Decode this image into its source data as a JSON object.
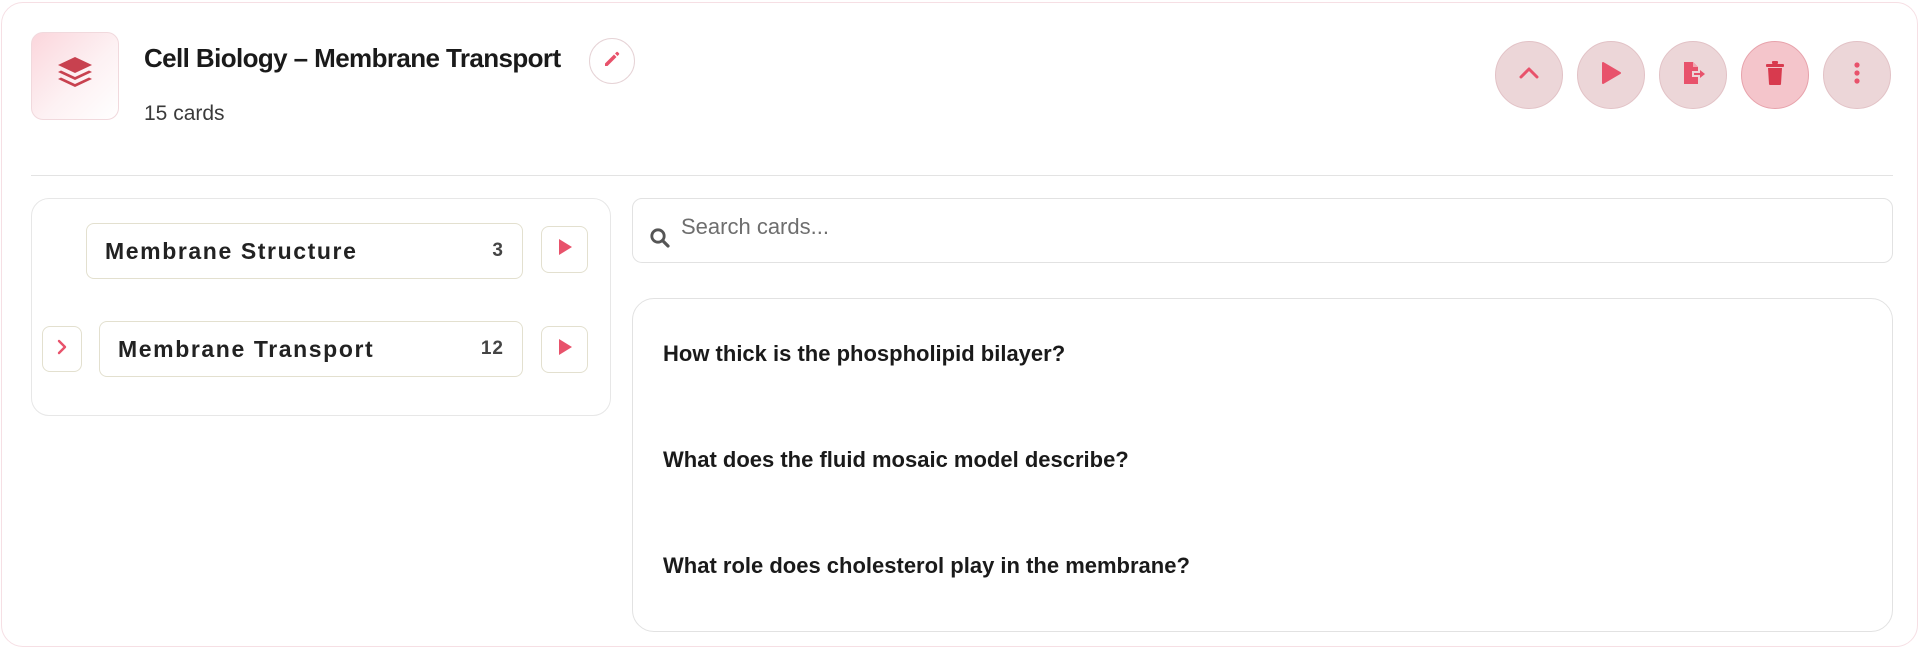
{
  "header": {
    "title": "Cell Biology – Membrane Transport",
    "count_text": "15 cards",
    "icons": {
      "deck": "stack-layers-icon",
      "edit": "pencil-icon"
    }
  },
  "actions": [
    {
      "name": "collapse-button",
      "icon": "chevron-up-icon"
    },
    {
      "name": "study-button",
      "icon": "play-icon"
    },
    {
      "name": "export-button",
      "icon": "file-export-icon"
    },
    {
      "name": "delete-button",
      "icon": "trash-icon"
    },
    {
      "name": "more-button",
      "icon": "more-vertical-icon"
    }
  ],
  "subdecks": [
    {
      "label": "Membrane Structure",
      "count": "3",
      "expandable": false
    },
    {
      "label": "Membrane Transport",
      "count": "12",
      "expandable": true
    }
  ],
  "search": {
    "placeholder": "Search cards...",
    "value": ""
  },
  "questions": [
    "How thick is the phospholipid bilayer?",
    "What does the fluid mosaic model describe?",
    "What role does cholesterol play in the membrane?"
  ],
  "colors": {
    "accent": "#e8526b",
    "accent_dark": "#c8414f",
    "danger_bg": "#f4c5cb",
    "button_bg": "#ecd6d8"
  }
}
